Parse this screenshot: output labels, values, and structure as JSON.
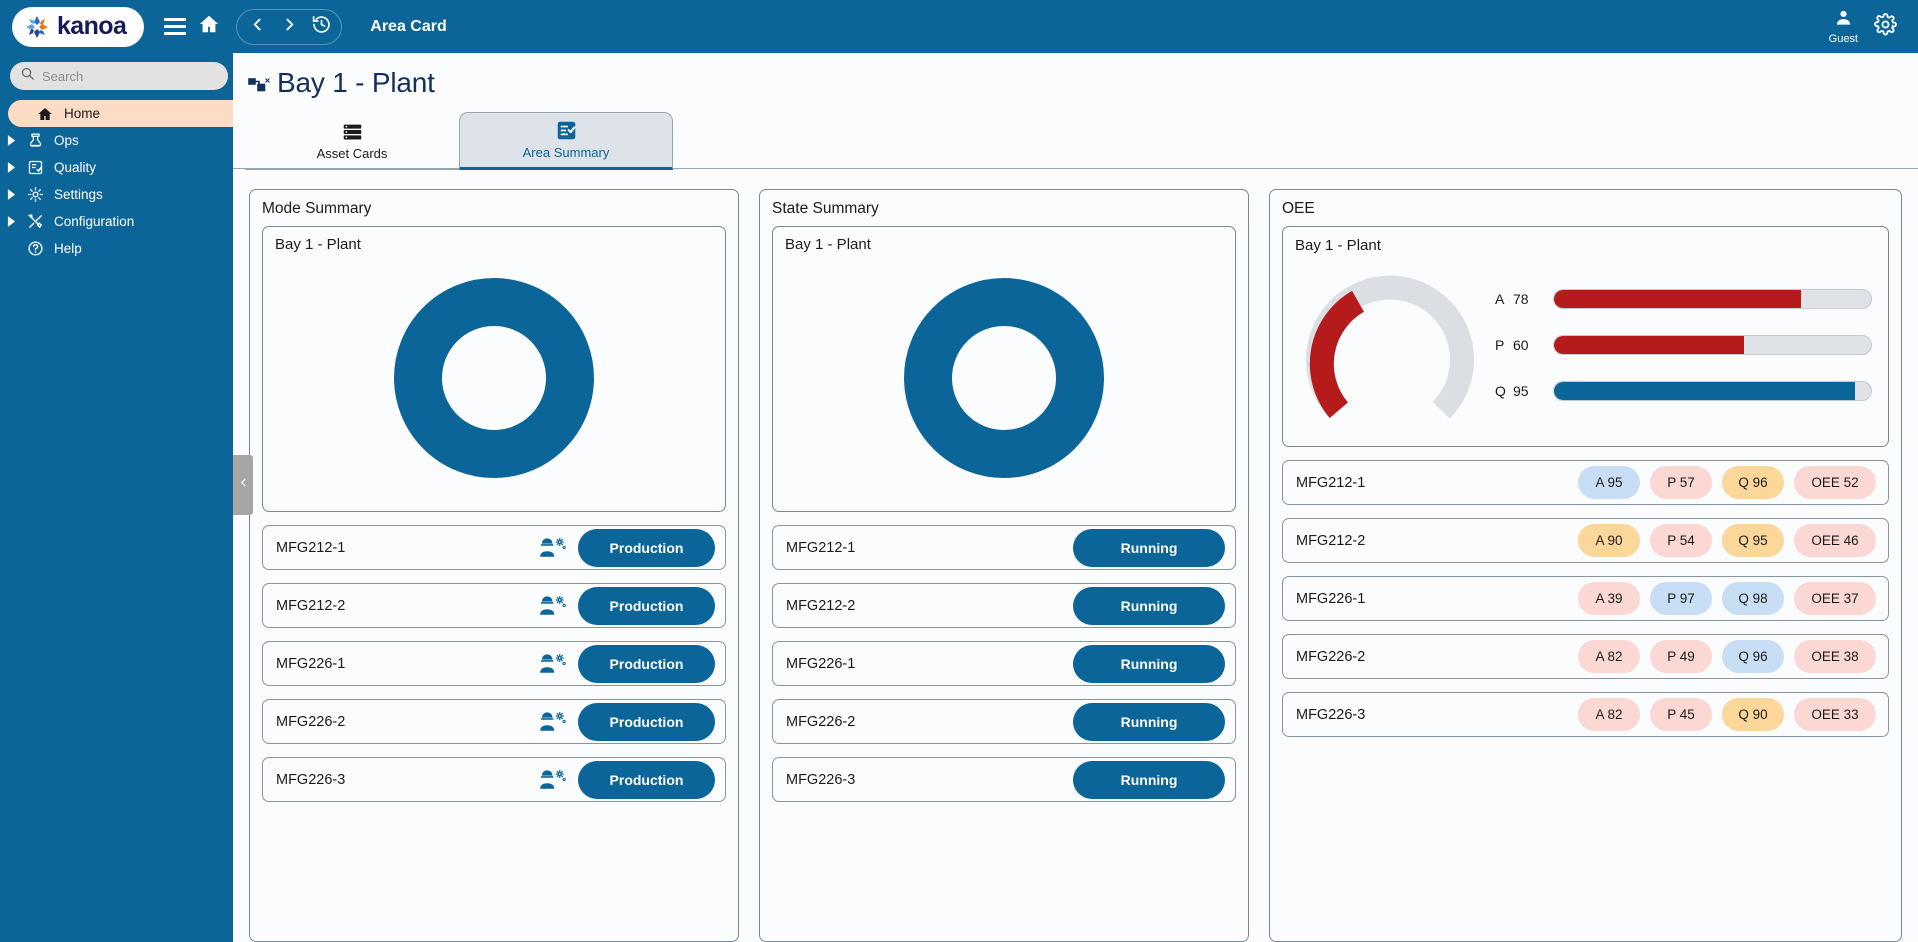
{
  "topbar": {
    "logo_text": "kanoa",
    "page_label": "Area Card",
    "menu_icon": "hamburger-icon",
    "home_icon": "home-icon",
    "back_icon": "chevron-left-icon",
    "forward_icon": "chevron-right-icon",
    "history_icon": "history-icon",
    "user_name": "Guest",
    "user_icon": "user-icon",
    "settings_icon": "gear-icon"
  },
  "sidebar": {
    "search": {
      "value": "",
      "placeholder": "Search",
      "icon": "search-icon"
    },
    "pin_icon": "pin-sidebar-icon",
    "items": [
      {
        "label": "Home",
        "icon": "home-icon",
        "active": true,
        "expandable": false
      },
      {
        "label": "Ops",
        "icon": "ops-icon",
        "active": false,
        "expandable": true
      },
      {
        "label": "Quality",
        "icon": "quality-icon",
        "active": false,
        "expandable": true
      },
      {
        "label": "Settings",
        "icon": "gear-icon",
        "active": false,
        "expandable": true
      },
      {
        "label": "Configuration",
        "icon": "tools-icon",
        "active": false,
        "expandable": true
      },
      {
        "label": "Help",
        "icon": "help-icon",
        "active": false,
        "expandable": false
      }
    ],
    "collapse_icon": "chevron-left-icon"
  },
  "page": {
    "title": "Bay 1 - Plant",
    "title_icon": "hierarchy-icon",
    "tabs": [
      {
        "label": "Asset Cards",
        "icon": "list-rows-icon",
        "active": false
      },
      {
        "label": "Area Summary",
        "icon": "checklist-icon",
        "active": true
      }
    ]
  },
  "mode_summary": {
    "title": "Mode Summary",
    "subtitle": "Bay 1 - Plant",
    "rows": [
      {
        "name": "MFG212-1",
        "status": "Production",
        "icon": "worker-gear-icon"
      },
      {
        "name": "MFG212-2",
        "status": "Production",
        "icon": "worker-gear-icon"
      },
      {
        "name": "MFG226-1",
        "status": "Production",
        "icon": "worker-gear-icon"
      },
      {
        "name": "MFG226-2",
        "status": "Production",
        "icon": "worker-gear-icon"
      },
      {
        "name": "MFG226-3",
        "status": "Production",
        "icon": "worker-gear-icon"
      }
    ],
    "chart_data": {
      "type": "pie",
      "title": "Mode Summary",
      "labels": [
        "Production"
      ],
      "values": [
        100
      ],
      "colors": [
        "#0b6598"
      ],
      "donut": true,
      "legend": "none"
    }
  },
  "state_summary": {
    "title": "State Summary",
    "subtitle": "Bay 1 - Plant",
    "rows": [
      {
        "name": "MFG212-1",
        "status": "Running"
      },
      {
        "name": "MFG212-2",
        "status": "Running"
      },
      {
        "name": "MFG226-1",
        "status": "Running"
      },
      {
        "name": "MFG226-2",
        "status": "Running"
      },
      {
        "name": "MFG226-3",
        "status": "Running"
      }
    ],
    "chart_data": {
      "type": "pie",
      "title": "State Summary",
      "labels": [
        "Running"
      ],
      "values": [
        100
      ],
      "colors": [
        "#0b6598"
      ],
      "donut": true,
      "legend": "none"
    }
  },
  "oee": {
    "title": "OEE",
    "subtitle": "Bay 1 - Plant",
    "gauge_value": "45",
    "gauge_color": "#b51b1b",
    "bars": [
      {
        "key": "A",
        "value": "78",
        "pct": 78,
        "color": "#b51b1b"
      },
      {
        "key": "P",
        "value": "60",
        "pct": 60,
        "color": "#b51b1b"
      },
      {
        "key": "Q",
        "value": "95",
        "pct": 95,
        "color": "#0b6598"
      }
    ],
    "rows": [
      {
        "name": "MFG212-1",
        "badges": [
          {
            "label": "A 95",
            "color": "#c8def5"
          },
          {
            "label": "P 57",
            "color": "#fbd8d3"
          },
          {
            "label": "Q 96",
            "color": "#fbd79a"
          },
          {
            "label": "OEE 52",
            "color": "#fbd8d3"
          }
        ]
      },
      {
        "name": "MFG212-2",
        "badges": [
          {
            "label": "A 90",
            "color": "#fbd79a"
          },
          {
            "label": "P 54",
            "color": "#fbd8d3"
          },
          {
            "label": "Q 95",
            "color": "#fbd79a"
          },
          {
            "label": "OEE 46",
            "color": "#fbd8d3"
          }
        ]
      },
      {
        "name": "MFG226-1",
        "badges": [
          {
            "label": "A 39",
            "color": "#fbd8d3"
          },
          {
            "label": "P 97",
            "color": "#c8def5"
          },
          {
            "label": "Q 98",
            "color": "#c8def5"
          },
          {
            "label": "OEE 37",
            "color": "#fbd8d3"
          }
        ]
      },
      {
        "name": "MFG226-2",
        "badges": [
          {
            "label": "A 82",
            "color": "#fbd8d3"
          },
          {
            "label": "P 49",
            "color": "#fbd8d3"
          },
          {
            "label": "Q 96",
            "color": "#c8def5"
          },
          {
            "label": "OEE 38",
            "color": "#fbd8d3"
          }
        ]
      },
      {
        "name": "MFG226-3",
        "badges": [
          {
            "label": "A 82",
            "color": "#fbd8d3"
          },
          {
            "label": "P 45",
            "color": "#fbd8d3"
          },
          {
            "label": "Q 90",
            "color": "#fbd79a"
          },
          {
            "label": "OEE 33",
            "color": "#fbd8d3"
          }
        ]
      }
    ],
    "chart_data": {
      "type": "bar",
      "title": "OEE",
      "categories": [
        "A",
        "P",
        "Q"
      ],
      "values": [
        78,
        60,
        95
      ],
      "ylim": [
        0,
        100
      ],
      "gauge": {
        "value": 45,
        "min": 0,
        "max": 100
      },
      "xlabel": "",
      "ylabel": ""
    }
  },
  "colors": {
    "brand_blue": "#0b6598",
    "accent_red": "#b51b1b",
    "sidebar_active": "#fcdcc5"
  }
}
